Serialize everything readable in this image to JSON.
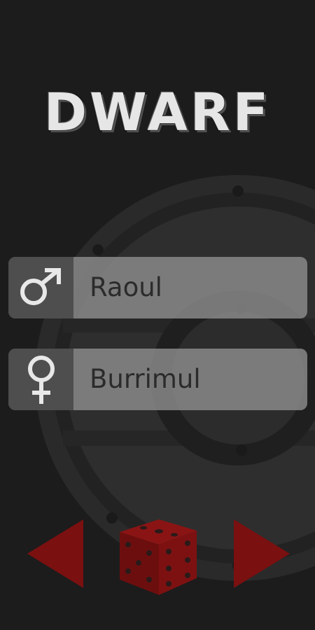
{
  "title": "DWARF",
  "names": {
    "male": {
      "name": "Raoul",
      "icon": "male-symbol-icon"
    },
    "female": {
      "name": "Burrimul",
      "icon": "female-symbol-icon"
    }
  },
  "controls": {
    "previous_icon": "triangle-left-icon",
    "randomize_icon": "dice-icon",
    "next_icon": "triangle-right-icon"
  },
  "colors": {
    "background": "#1c1c1c",
    "accent_red": "#7a1010",
    "title": "#e6e6e6"
  }
}
